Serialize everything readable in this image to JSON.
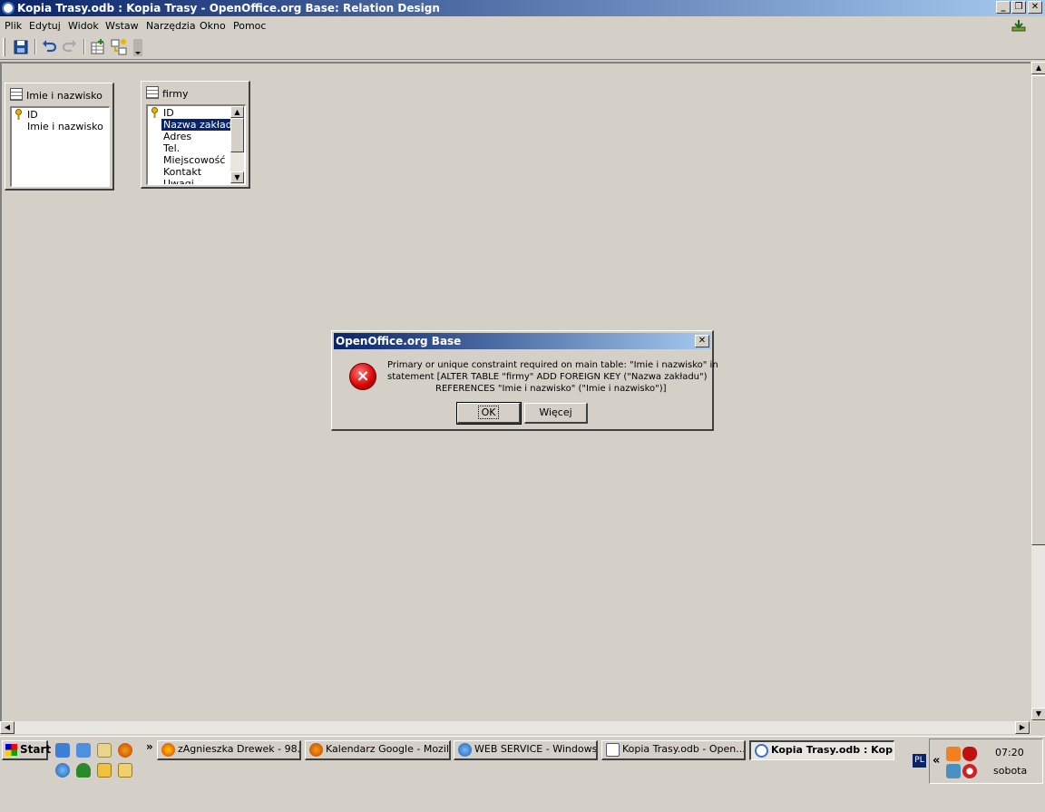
{
  "window": {
    "title": "Kopia Trasy.odb : Kopia Trasy - OpenOffice.org Base: Relation Design",
    "minimize": "_",
    "restore": "❐",
    "close": "✕"
  },
  "menu": {
    "items": [
      "Plik",
      "Edytuj",
      "Widok",
      "Wstaw",
      "Narzędzia",
      "Okno",
      "Pomoc"
    ]
  },
  "tables": {
    "t1": {
      "title": "Imie i nazwisko",
      "fields": [
        "ID",
        "Imie i nazwisko"
      ]
    },
    "t2": {
      "title": "firmy",
      "fields": [
        "ID",
        "Nazwa zakładu",
        "Adres",
        "Tel.",
        "Miejscowość",
        "Kontakt",
        "Uwagi"
      ],
      "selected": "Nazwa zakładu"
    }
  },
  "dialog": {
    "title": "OpenOffice.org Base",
    "close": "✕",
    "icon": "×",
    "message_lines": [
      "Primary or unique constraint required on main table: \"Imie i nazwisko\" in",
      "statement [ALTER TABLE \"firmy\" ADD  FOREIGN KEY (\"Nazwa zakładu\")",
      "REFERENCES \"Imie i nazwisko\" (\"Imie i nazwisko\")]"
    ],
    "ok_label": "OK",
    "more_label": "Więcej"
  },
  "taskbar": {
    "start_label": "Start",
    "more_glyph": "»",
    "tasks": [
      "zAgnieszka  Drewek - 98...",
      "Kalendarz Google - Mozill...",
      "WEB SERVICE - Windows...",
      "Kopia Trasy.odb - Open...",
      "Kopia Trasy.odb : Kopi..."
    ],
    "lang": "PL",
    "tray_chevron": "«",
    "time": "07:20",
    "day": "sobota"
  },
  "colors": {
    "titlebar_start": "#0a246a",
    "titlebar_end": "#a6caf0",
    "selection": "#0a246a",
    "error_red": "#d40000"
  }
}
